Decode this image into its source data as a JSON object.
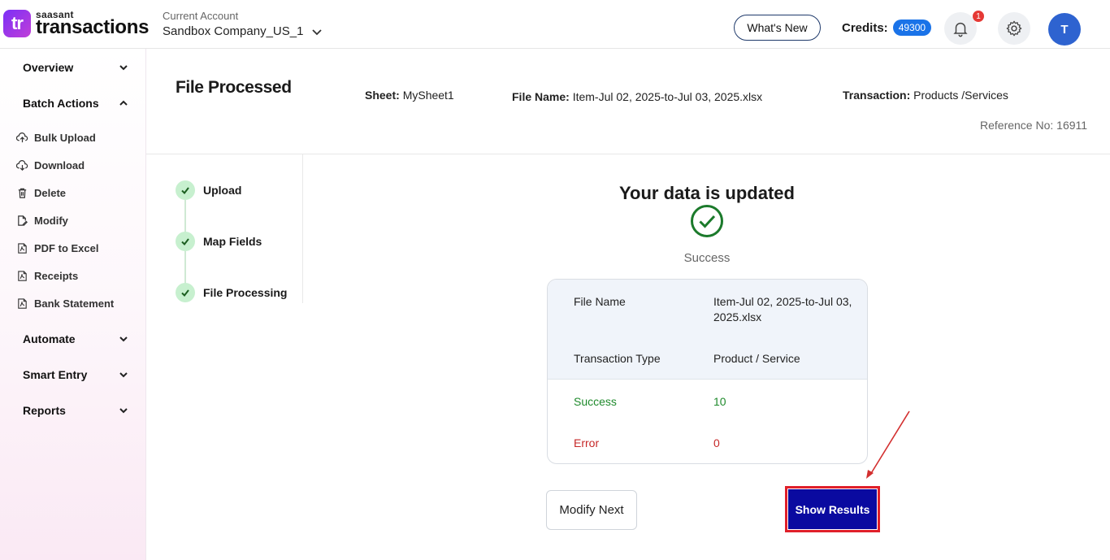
{
  "header": {
    "brand": "saasant",
    "product": "transactions",
    "logo_mark": "tr",
    "account_label": "Current Account",
    "account_value": "Sandbox Company_US_1",
    "whats_new": "What's New",
    "credits_label": "Credits:",
    "credits_value": "49300",
    "notification_count": "1",
    "avatar_initial": "T"
  },
  "sidebar": {
    "sections": [
      {
        "label": "Overview",
        "state": "collapsed"
      },
      {
        "label": "Batch Actions",
        "state": "expanded"
      },
      {
        "label": "Automate",
        "state": "collapsed"
      },
      {
        "label": "Smart Entry",
        "state": "collapsed"
      },
      {
        "label": "Reports",
        "state": "collapsed"
      }
    ],
    "items": [
      {
        "label": "Bulk Upload",
        "icon": "upload-cloud-icon"
      },
      {
        "label": "Download",
        "icon": "download-cloud-icon"
      },
      {
        "label": "Delete",
        "icon": "trash-icon"
      },
      {
        "label": "Modify",
        "icon": "edit-file-icon"
      },
      {
        "label": "PDF to Excel",
        "icon": "pdf-icon"
      },
      {
        "label": "Receipts",
        "icon": "pdf-icon"
      },
      {
        "label": "Bank Statement",
        "icon": "pdf-icon"
      }
    ]
  },
  "page": {
    "title": "File Processed",
    "sheet_label": "Sheet:",
    "sheet_value": "MySheet1",
    "file_label": "File Name:",
    "file_value": "Item-Jul 02, 2025-to-Jul 03, 2025.xlsx",
    "transaction_label": "Transaction:",
    "transaction_value": "Products /Services",
    "reference": "Reference No: 16911"
  },
  "steps": [
    {
      "label": "Upload",
      "status": "done"
    },
    {
      "label": "Map Fields",
      "status": "done"
    },
    {
      "label": "File Processing",
      "status": "done"
    }
  ],
  "result": {
    "title": "Your data is updated",
    "status": "Success",
    "rows": {
      "file_name_label": "File Name",
      "file_name_value": "Item-Jul 02, 2025-to-Jul 03, 2025.xlsx",
      "type_label": "Transaction Type",
      "type_value": "Product / Service",
      "success_label": "Success",
      "success_value": "10",
      "error_label": "Error",
      "error_value": "0"
    },
    "modify_button": "Modify Next",
    "results_button": "Show Results"
  },
  "colors": {
    "accent": "#0a0aa0",
    "success": "#1f8a2c",
    "error": "#c62828",
    "highlight": "#e0202a",
    "credits_badge": "#1a73e8"
  }
}
